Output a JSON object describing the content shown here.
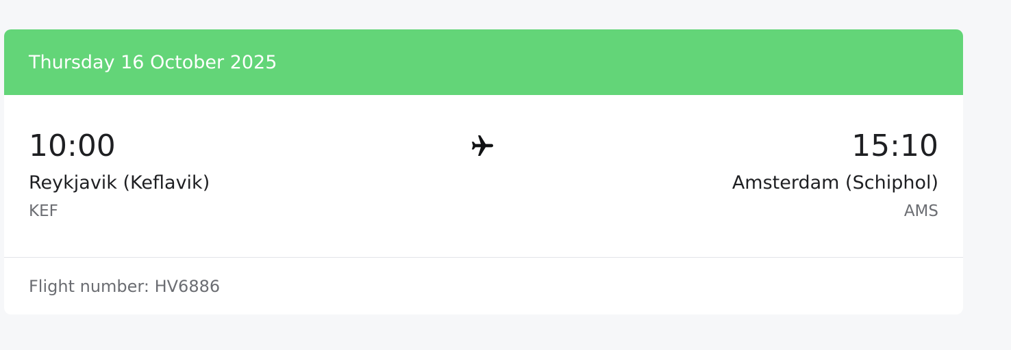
{
  "header": {
    "date": "Thursday 16 October 2025"
  },
  "departure": {
    "time": "10:00",
    "city": "Reykjavik (Keflavik)",
    "code": "KEF"
  },
  "arrival": {
    "time": "15:10",
    "city": "Amsterdam (Schiphol)",
    "code": "AMS"
  },
  "icons": {
    "route": "airplane-icon"
  },
  "footer": {
    "flight_number": "Flight number: HV6886"
  },
  "colors": {
    "header_background": "#63d578",
    "header_text": "#ffffff",
    "primary_text": "#1e1f22",
    "secondary_text": "#6b6d72",
    "page_background": "#f6f7f9"
  }
}
